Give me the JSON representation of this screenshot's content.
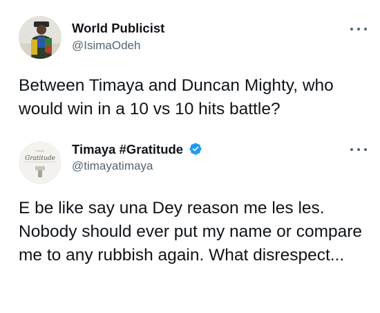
{
  "tweets": [
    {
      "display_name": "World Publicist",
      "handle": "@IsimaOdeh",
      "text": "Between Timaya and Duncan Mighty, who would win in a 10 vs 10 hits battle?",
      "verified": false,
      "avatar_icon": "profile-photo"
    },
    {
      "display_name": "Timaya #Gratitude",
      "handle": "@timayatimaya",
      "text": "E be like say una Dey reason me les les. Nobody should ever put my name or compare me to any rubbish again. What disrespect...",
      "verified": true,
      "avatar_icon": "gratitude-logo",
      "avatar_text": "Gratitude"
    }
  ],
  "colors": {
    "text": "#0f1419",
    "secondary": "#536471",
    "verified": "#1d9bf0",
    "background": "#ffffff"
  }
}
